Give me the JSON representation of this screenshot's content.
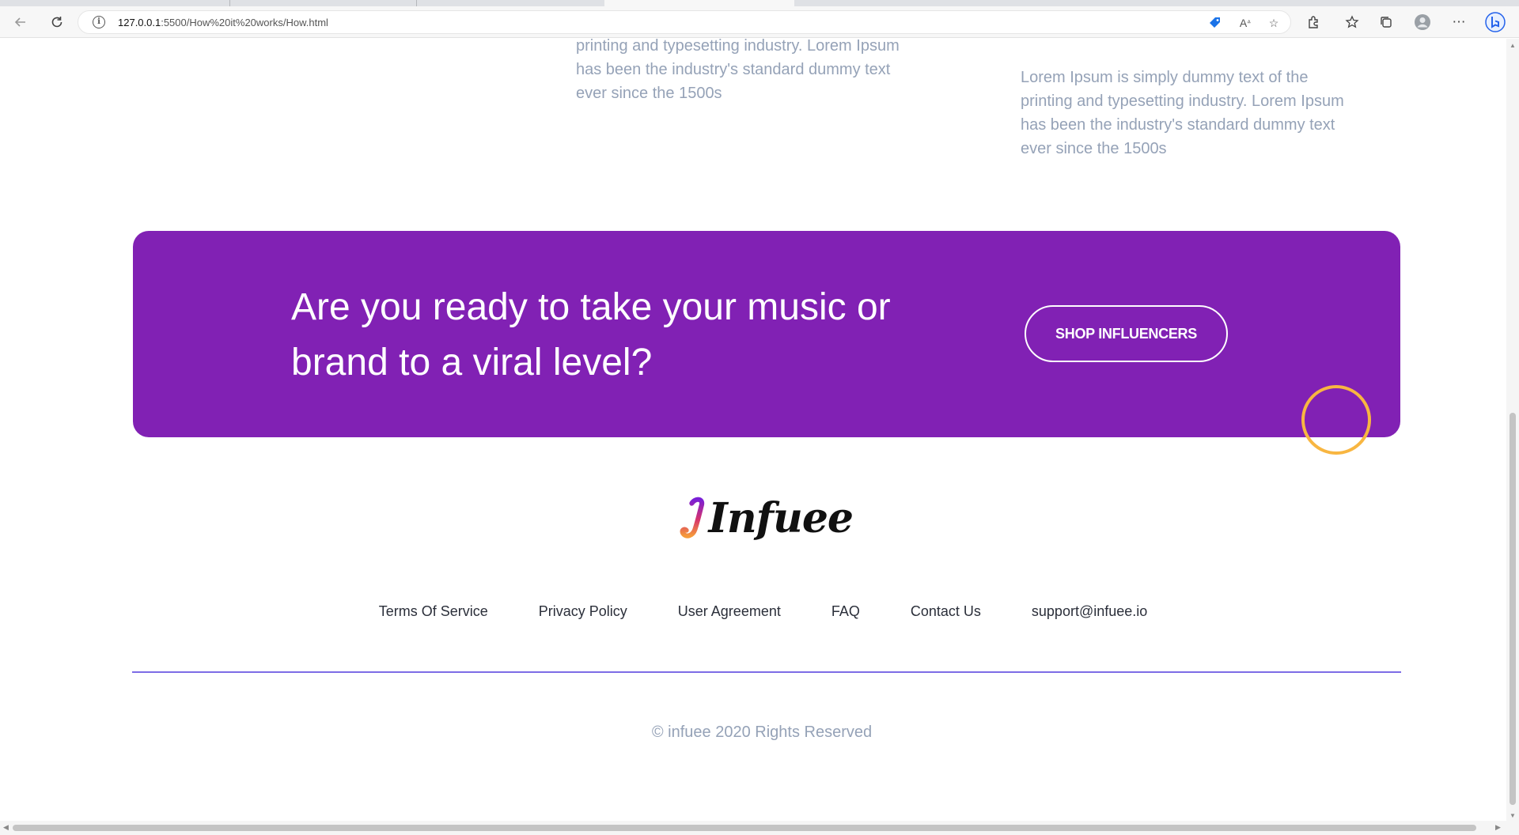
{
  "browser": {
    "url_host": "127.0.0.1",
    "url_rest": ":5500/How%20it%20works/How.html"
  },
  "content": {
    "col1_text": "ever since the 1500s",
    "col2_text": "printing and typesetting industry. Lorem Ipsum has been the industry's standard dummy text ever since the 1500s",
    "col3_text": "Lorem Ipsum is simply dummy text of the printing and typesetting industry. Lorem Ipsum has been the industry's standard dummy text ever since the 1500s"
  },
  "cta": {
    "heading": "Are you ready to take your music or brand to a viral level?",
    "button_label": "SHOP INFLUENCERS",
    "background": "#8121b4"
  },
  "logo": {
    "text": "Infuee"
  },
  "footer": {
    "links": [
      "Terms Of Service",
      "Privacy Policy",
      "User Agreement",
      "FAQ",
      "Contact Us",
      "support@infuee.io"
    ],
    "copyright": "© infuee 2020 Rights Reserved",
    "divider_color": "#7d6ce6"
  },
  "colors": {
    "body_text": "#95a2b7",
    "cursor_ring": "#f8b641"
  }
}
